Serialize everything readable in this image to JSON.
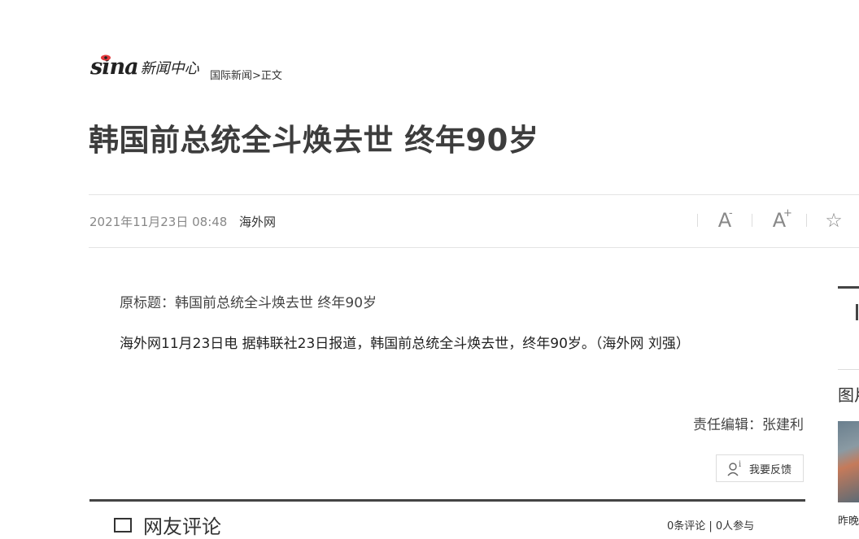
{
  "header": {
    "logo_sina": "sina",
    "logo_channel": "新闻中心",
    "breadcrumb": {
      "section": "国际新闻",
      "separator": ">",
      "current": "正文"
    }
  },
  "article": {
    "title": "韩国前总统全斗焕去世 终年90岁",
    "date": "2021年11月23日 08:48",
    "source": "海外网",
    "original_title": "原标题：韩国前总统全斗焕去世 终年90岁",
    "body": "海外网11月23日电 据韩联社23日报道，韩国前总统全斗焕去世，终年90岁。（海外网 刘强）",
    "editor": "责任编辑：张建利"
  },
  "toolbar": {
    "font_decrease_label": "A",
    "font_decrease_sup": "-",
    "font_increase_label": "A",
    "font_increase_sup": "+",
    "favorite_label": "☆"
  },
  "feedback": {
    "label": "我要反馈"
  },
  "comments": {
    "title": "网友评论",
    "stats": "0条评论 | 0人参与"
  },
  "sidebar": {
    "label": "图片",
    "caption": "昨晚"
  }
}
